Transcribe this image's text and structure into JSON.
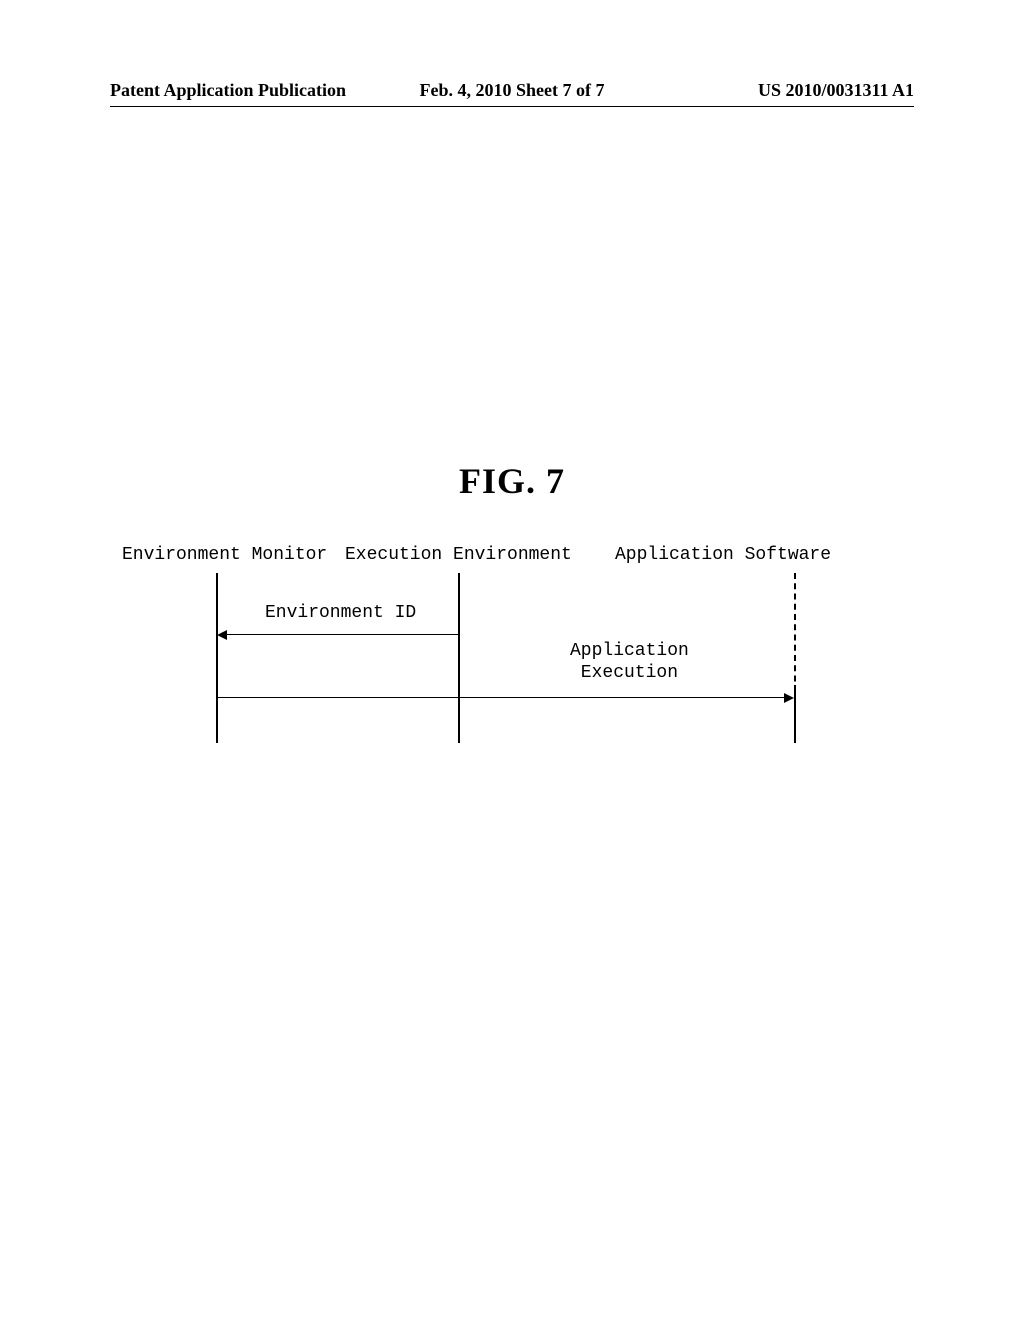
{
  "header": {
    "left": "Patent Application Publication",
    "center": "Feb. 4, 2010  Sheet 7 of 7",
    "right": "US 2010/0031311 A1"
  },
  "figure": {
    "title": "FIG.  7",
    "participants": {
      "p1": "Environment Monitor",
      "p2": "Execution Environment",
      "p3": "Application Software"
    },
    "messages": {
      "m1": "Environment ID",
      "m2_line1": "Application",
      "m2_line2": "Execution"
    }
  }
}
